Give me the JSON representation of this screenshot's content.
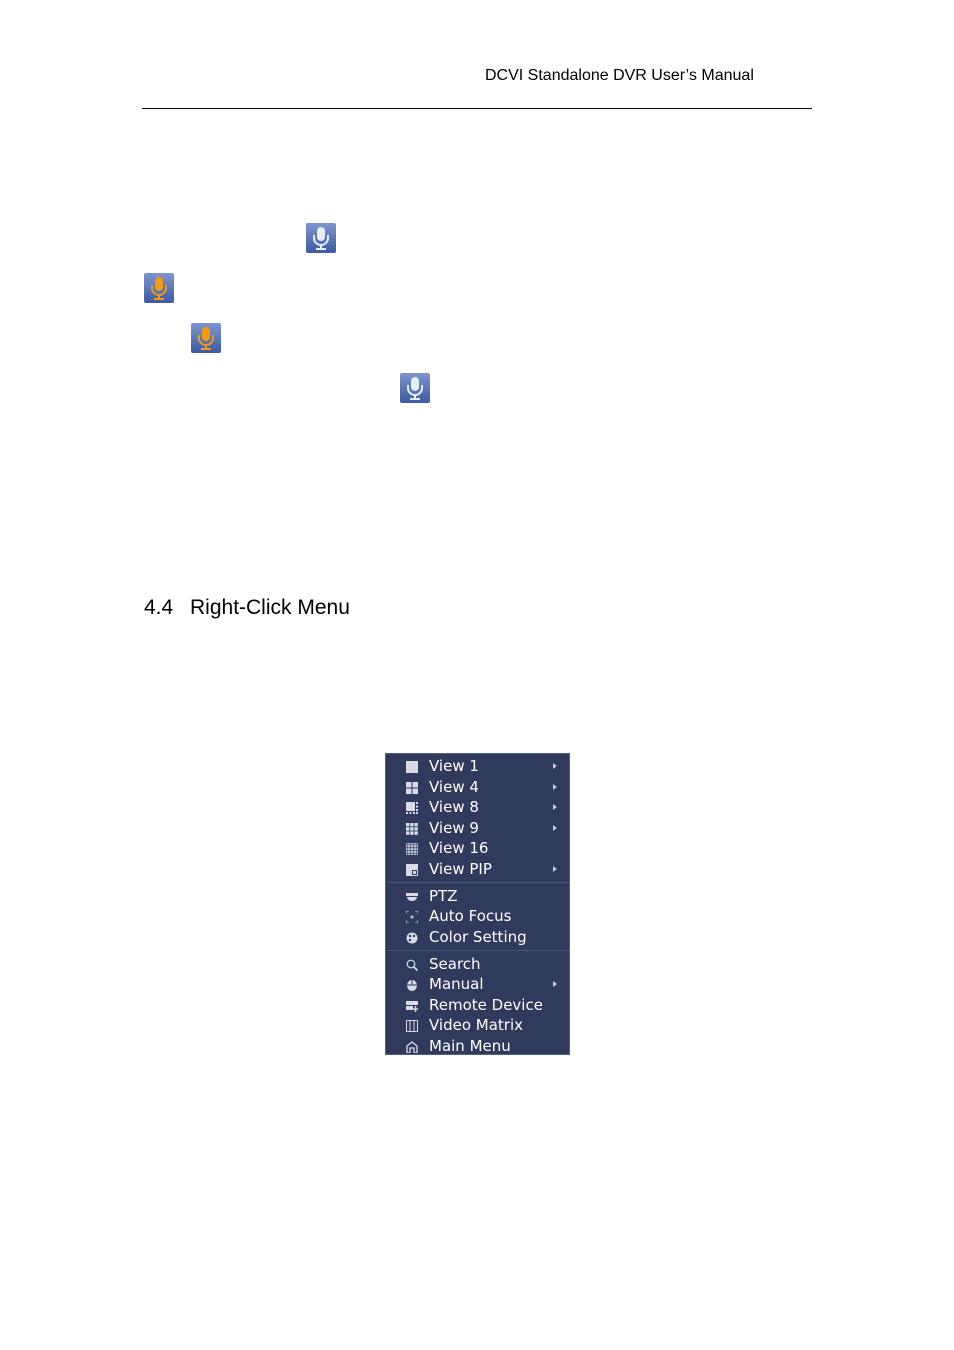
{
  "header": {
    "title": "DCVI Standalone DVR User’s Manual"
  },
  "icons": [
    {
      "name": "mic-icon-inactive",
      "state": "inactive",
      "color": "#ffffff"
    },
    {
      "name": "mic-icon-active",
      "state": "active",
      "color": "#f08a00"
    },
    {
      "name": "mic-icon-active",
      "state": "active",
      "color": "#f08a00"
    },
    {
      "name": "mic-icon-inactive",
      "state": "inactive",
      "color": "#ffffff"
    }
  ],
  "section": {
    "number": "4.4",
    "title": "Right-Click Menu"
  },
  "menu": {
    "background": "#303a5c",
    "groups": [
      [
        {
          "label": "View 1",
          "icon": "view1-icon",
          "submenu": true
        },
        {
          "label": "View 4",
          "icon": "view4-icon",
          "submenu": true
        },
        {
          "label": "View 8",
          "icon": "view8-icon",
          "submenu": true
        },
        {
          "label": "View 9",
          "icon": "view9-icon",
          "submenu": true
        },
        {
          "label": "View 16",
          "icon": "view16-icon",
          "submenu": false
        },
        {
          "label": "View PIP",
          "icon": "view-pip-icon",
          "submenu": true
        }
      ],
      [
        {
          "label": "PTZ",
          "icon": "ptz-icon",
          "submenu": false
        },
        {
          "label": "Auto Focus",
          "icon": "auto-focus-icon",
          "submenu": false
        },
        {
          "label": "Color Setting",
          "icon": "color-setting-icon",
          "submenu": false
        }
      ],
      [
        {
          "label": "Search",
          "icon": "search-icon",
          "submenu": false
        },
        {
          "label": "Manual",
          "icon": "manual-icon",
          "submenu": true
        },
        {
          "label": "Remote Device",
          "icon": "remote-device-icon",
          "submenu": false
        },
        {
          "label": "Video Matrix",
          "icon": "video-matrix-icon",
          "submenu": false
        },
        {
          "label": "Main Menu",
          "icon": "main-menu-icon",
          "submenu": false
        }
      ]
    ]
  }
}
